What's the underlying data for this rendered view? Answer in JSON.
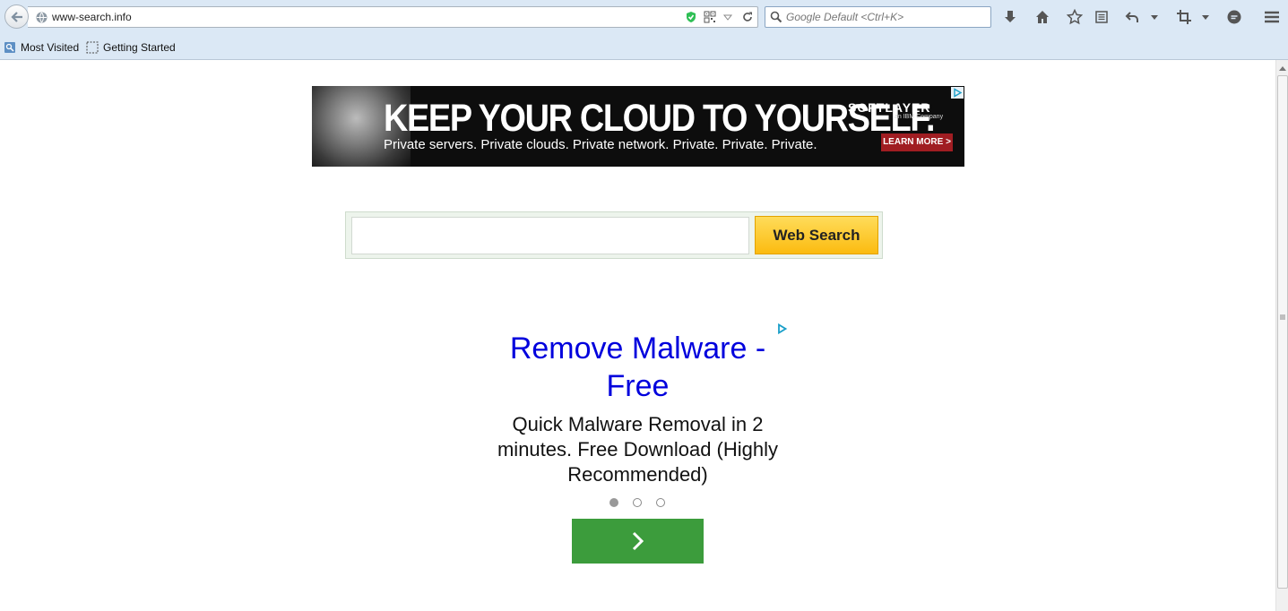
{
  "browser": {
    "url": "www-search.info",
    "search_placeholder": "Google Default <Ctrl+K>",
    "bookmarks": [
      {
        "label": "Most Visited"
      },
      {
        "label": "Getting Started"
      }
    ]
  },
  "banner": {
    "headline": "KEEP YOUR CLOUD TO YOURSELF.",
    "subline": "Private servers. Private clouds. Private network. Private. Private. Private.",
    "brand": "SOFTLAYER",
    "brand_sub": "an IBM Company",
    "cta": "LEARN MORE >"
  },
  "search": {
    "input_value": "",
    "button_label": "Web Search"
  },
  "ad": {
    "title": "Remove Malware - Free",
    "description": "Quick Malware Removal in 2 minutes. Free Download (Highly Recommended)",
    "carousel_count": 3,
    "active_index": 0
  },
  "colors": {
    "chrome": "#dbe8f5",
    "ad_title": "#0000dd",
    "next_button": "#3c9c3c",
    "search_button": "#fbbb10"
  }
}
